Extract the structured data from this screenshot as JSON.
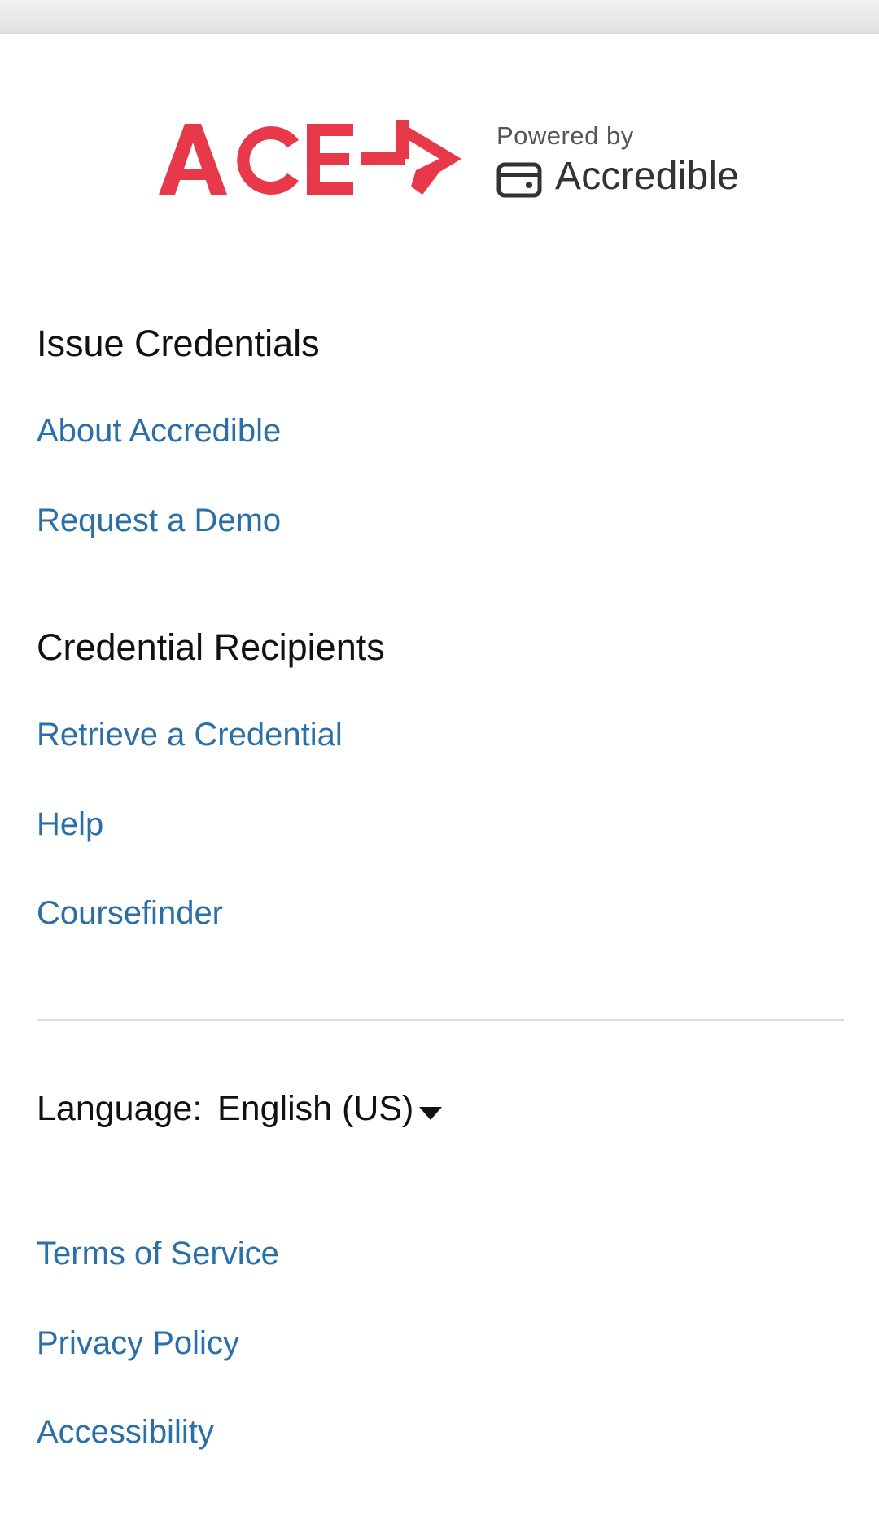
{
  "branding": {
    "ace_logo": "ACE",
    "powered_by": "Powered by",
    "accredible_name": "Accredible",
    "ace_red": "#e8394a"
  },
  "issue_section": {
    "heading": "Issue Credentials",
    "links": [
      "About Accredible",
      "Request a Demo"
    ]
  },
  "recipients_section": {
    "heading": "Credential Recipients",
    "links": [
      "Retrieve a Credential",
      "Help",
      "Coursefinder"
    ]
  },
  "language": {
    "label": "Language:",
    "selected": "English (US)"
  },
  "legal_links": [
    "Terms of Service",
    "Privacy Policy",
    "Accessibility"
  ],
  "colors": {
    "link": "#2a6fa8",
    "heading": "#111111",
    "divider": "#dddddd"
  },
  "icons": {
    "accredible": "accredible-wallet-icon",
    "dropdown": "caret-down-icon"
  }
}
